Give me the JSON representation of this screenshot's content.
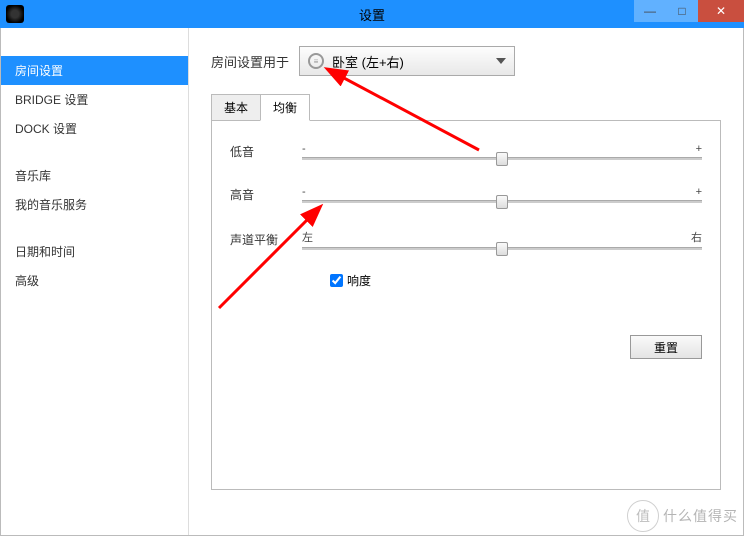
{
  "window": {
    "title": "设置",
    "buttons": {
      "min": "—",
      "max": "□",
      "close": "✕"
    }
  },
  "sidebar": {
    "items": [
      {
        "label": "房间设置",
        "selected": true
      },
      {
        "label": "BRIDGE 设置",
        "selected": false
      },
      {
        "label": "DOCK 设置",
        "selected": false
      }
    ],
    "group2": [
      {
        "label": "音乐库"
      },
      {
        "label": "我的音乐服务"
      }
    ],
    "group3": [
      {
        "label": "日期和时间"
      },
      {
        "label": "高级"
      }
    ]
  },
  "main": {
    "apply_label": "房间设置用于",
    "dropdown_value": "卧室 (左+右)",
    "tabs": {
      "basic": "基本",
      "eq": "均衡"
    },
    "sliders": {
      "bass": {
        "label": "低音",
        "left": "-",
        "right": "+",
        "pos": 50
      },
      "treble": {
        "label": "高音",
        "left": "-",
        "right": "+",
        "pos": 50
      },
      "balance": {
        "label": "声道平衡",
        "left": "左",
        "right": "右",
        "pos": 50
      }
    },
    "loudness_label": "响度",
    "loudness_checked": true,
    "reset_label": "重置"
  },
  "watermark": {
    "icon": "值",
    "text": "什么值得买"
  }
}
